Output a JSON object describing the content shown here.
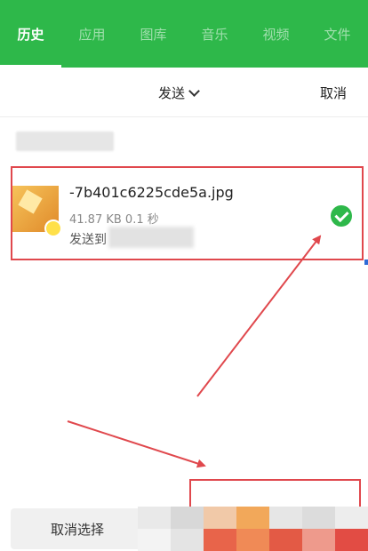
{
  "tabs": [
    {
      "label": "历史",
      "active": true
    },
    {
      "label": "应用",
      "active": false
    },
    {
      "label": "图库",
      "active": false
    },
    {
      "label": "音乐",
      "active": false
    },
    {
      "label": "视频",
      "active": false
    },
    {
      "label": "文件",
      "active": false
    }
  ],
  "header": {
    "send_label": "发送",
    "cancel_label": "取消"
  },
  "file_item": {
    "name": "-7b401c6225cde5a.jpg",
    "meta": "41.87 KB 0.1 秒",
    "target_prefix": "发送到",
    "selected": true
  },
  "bottom": {
    "cancel_select_label": "取消选择"
  },
  "colors": {
    "brand_green": "#2eb84a",
    "annotation_red": "#e0484d"
  }
}
